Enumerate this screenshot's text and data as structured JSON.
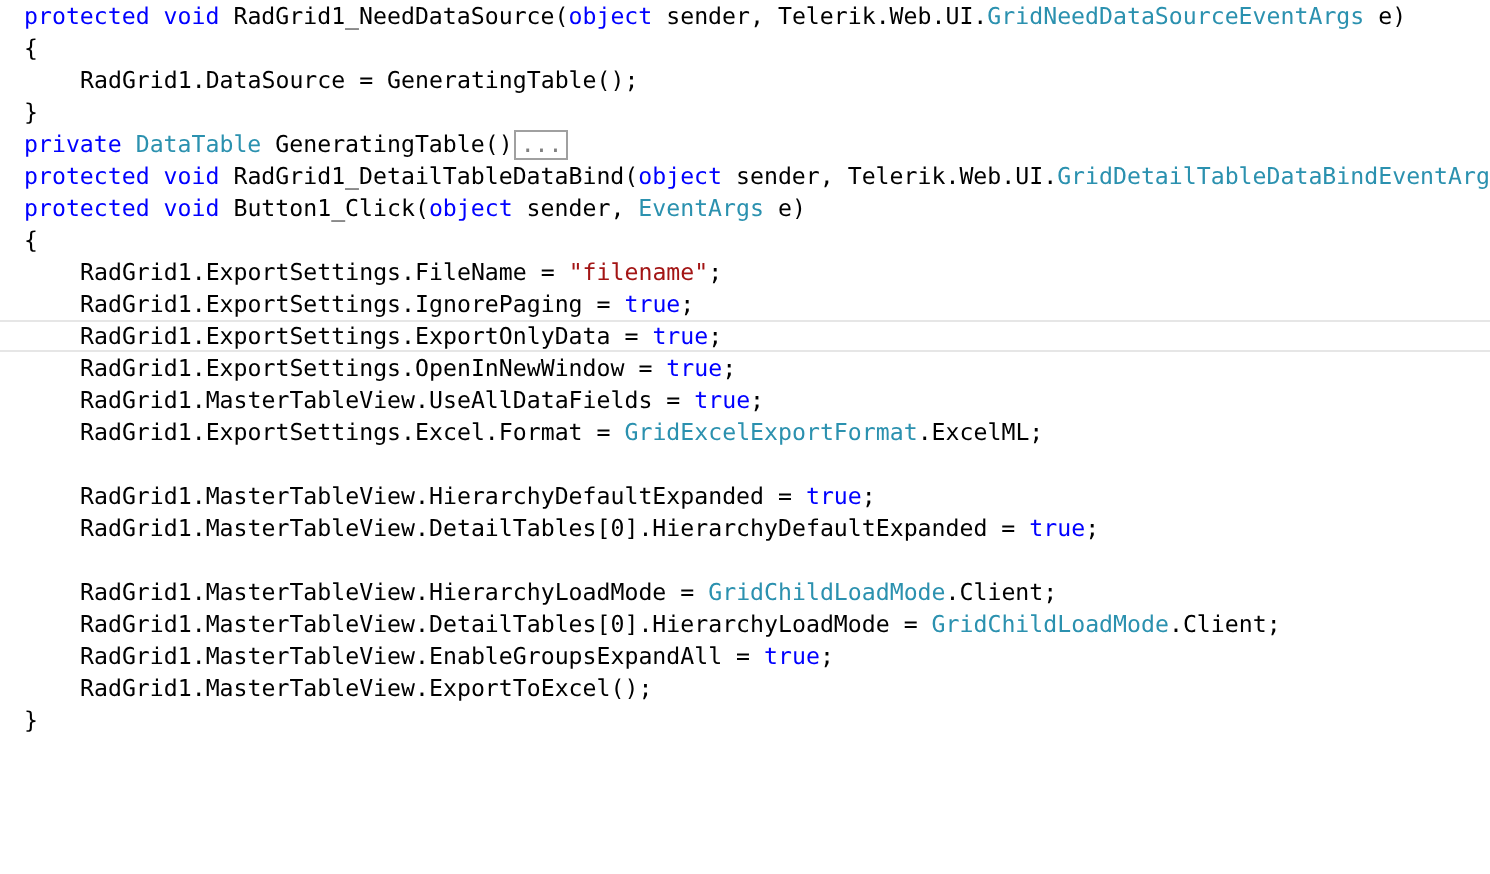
{
  "editor": {
    "lines": [
      {
        "kind": "code",
        "indent": false,
        "current": false,
        "tokens": [
          {
            "kind": "keyword",
            "text": "protected void"
          },
          {
            "kind": "plain",
            "text": " RadGrid1_NeedDataSource("
          },
          {
            "kind": "keyword",
            "text": "object"
          },
          {
            "kind": "plain",
            "text": " sender, Telerik.Web.UI."
          },
          {
            "kind": "type",
            "text": "GridNeedDataSourceEventArgs"
          },
          {
            "kind": "plain",
            "text": " e)"
          }
        ]
      },
      {
        "kind": "code",
        "indent": false,
        "current": false,
        "tokens": [
          {
            "kind": "plain",
            "text": "{"
          }
        ]
      },
      {
        "kind": "code",
        "indent": true,
        "current": false,
        "tokens": [
          {
            "kind": "plain",
            "text": "RadGrid1.DataSource = GeneratingTable();"
          }
        ]
      },
      {
        "kind": "code",
        "indent": false,
        "current": false,
        "tokens": [
          {
            "kind": "plain",
            "text": "}"
          }
        ]
      },
      {
        "kind": "code",
        "indent": false,
        "current": false,
        "tokens": [
          {
            "kind": "keyword",
            "text": "private "
          },
          {
            "kind": "type",
            "text": "DataTable"
          },
          {
            "kind": "plain",
            "text": " GeneratingTable()"
          }
        ],
        "collapsed": "..."
      },
      {
        "kind": "code",
        "indent": false,
        "current": false,
        "tokens": [
          {
            "kind": "keyword",
            "text": "protected void"
          },
          {
            "kind": "plain",
            "text": " RadGrid1_DetailTableDataBind("
          },
          {
            "kind": "keyword",
            "text": "object"
          },
          {
            "kind": "plain",
            "text": " sender, Telerik.Web.UI."
          },
          {
            "kind": "type",
            "text": "GridDetailTableDataBindEventArg"
          }
        ]
      },
      {
        "kind": "code",
        "indent": false,
        "current": false,
        "tokens": [
          {
            "kind": "keyword",
            "text": "protected void"
          },
          {
            "kind": "plain",
            "text": " Button1_Click("
          },
          {
            "kind": "keyword",
            "text": "object"
          },
          {
            "kind": "plain",
            "text": " sender, "
          },
          {
            "kind": "type",
            "text": "EventArgs"
          },
          {
            "kind": "plain",
            "text": " e)"
          }
        ]
      },
      {
        "kind": "code",
        "indent": false,
        "current": false,
        "tokens": [
          {
            "kind": "plain",
            "text": "{"
          }
        ]
      },
      {
        "kind": "code",
        "indent": true,
        "current": false,
        "tokens": [
          {
            "kind": "plain",
            "text": "RadGrid1.ExportSettings.FileName = "
          },
          {
            "kind": "string",
            "text": "\"filename\""
          },
          {
            "kind": "plain",
            "text": ";"
          }
        ]
      },
      {
        "kind": "code",
        "indent": true,
        "current": false,
        "tokens": [
          {
            "kind": "plain",
            "text": "RadGrid1.ExportSettings.IgnorePaging = "
          },
          {
            "kind": "keyword",
            "text": "true"
          },
          {
            "kind": "plain",
            "text": ";"
          }
        ]
      },
      {
        "kind": "code",
        "indent": true,
        "current": true,
        "tokens": [
          {
            "kind": "plain",
            "text": "RadGrid1.ExportSettings.ExportOnlyData = "
          },
          {
            "kind": "keyword",
            "text": "true"
          },
          {
            "kind": "plain",
            "text": ";"
          }
        ]
      },
      {
        "kind": "code",
        "indent": true,
        "current": false,
        "tokens": [
          {
            "kind": "plain",
            "text": "RadGrid1.ExportSettings.OpenInNewWindow = "
          },
          {
            "kind": "keyword",
            "text": "true"
          },
          {
            "kind": "plain",
            "text": ";"
          }
        ]
      },
      {
        "kind": "code",
        "indent": true,
        "current": false,
        "tokens": [
          {
            "kind": "plain",
            "text": "RadGrid1.MasterTableView.UseAllDataFields = "
          },
          {
            "kind": "keyword",
            "text": "true"
          },
          {
            "kind": "plain",
            "text": ";"
          }
        ]
      },
      {
        "kind": "code",
        "indent": true,
        "current": false,
        "tokens": [
          {
            "kind": "plain",
            "text": "RadGrid1.ExportSettings.Excel.Format = "
          },
          {
            "kind": "type",
            "text": "GridExcelExportFormat"
          },
          {
            "kind": "plain",
            "text": ".ExcelML;"
          }
        ]
      },
      {
        "kind": "blank"
      },
      {
        "kind": "code",
        "indent": true,
        "current": false,
        "tokens": [
          {
            "kind": "plain",
            "text": "RadGrid1.MasterTableView.HierarchyDefaultExpanded = "
          },
          {
            "kind": "keyword",
            "text": "true"
          },
          {
            "kind": "plain",
            "text": ";"
          }
        ]
      },
      {
        "kind": "code",
        "indent": true,
        "current": false,
        "tokens": [
          {
            "kind": "plain",
            "text": "RadGrid1.MasterTableView.DetailTables[0].HierarchyDefaultExpanded = "
          },
          {
            "kind": "keyword",
            "text": "true"
          },
          {
            "kind": "plain",
            "text": ";"
          }
        ]
      },
      {
        "kind": "blank"
      },
      {
        "kind": "code",
        "indent": true,
        "current": false,
        "tokens": [
          {
            "kind": "plain",
            "text": "RadGrid1.MasterTableView.HierarchyLoadMode = "
          },
          {
            "kind": "type",
            "text": "GridChildLoadMode"
          },
          {
            "kind": "plain",
            "text": ".Client;"
          }
        ]
      },
      {
        "kind": "code",
        "indent": true,
        "current": false,
        "tokens": [
          {
            "kind": "plain",
            "text": "RadGrid1.MasterTableView.DetailTables[0].HierarchyLoadMode = "
          },
          {
            "kind": "type",
            "text": "GridChildLoadMode"
          },
          {
            "kind": "plain",
            "text": ".Client;"
          }
        ]
      },
      {
        "kind": "code",
        "indent": true,
        "current": false,
        "tokens": [
          {
            "kind": "plain",
            "text": "RadGrid1.MasterTableView.EnableGroupsExpandAll = "
          },
          {
            "kind": "keyword",
            "text": "true"
          },
          {
            "kind": "plain",
            "text": ";"
          }
        ]
      },
      {
        "kind": "code",
        "indent": true,
        "current": false,
        "tokens": [
          {
            "kind": "plain",
            "text": "RadGrid1.MasterTableView.ExportToExcel();"
          }
        ]
      },
      {
        "kind": "code",
        "indent": false,
        "current": false,
        "tokens": [
          {
            "kind": "plain",
            "text": "}"
          }
        ]
      }
    ]
  }
}
